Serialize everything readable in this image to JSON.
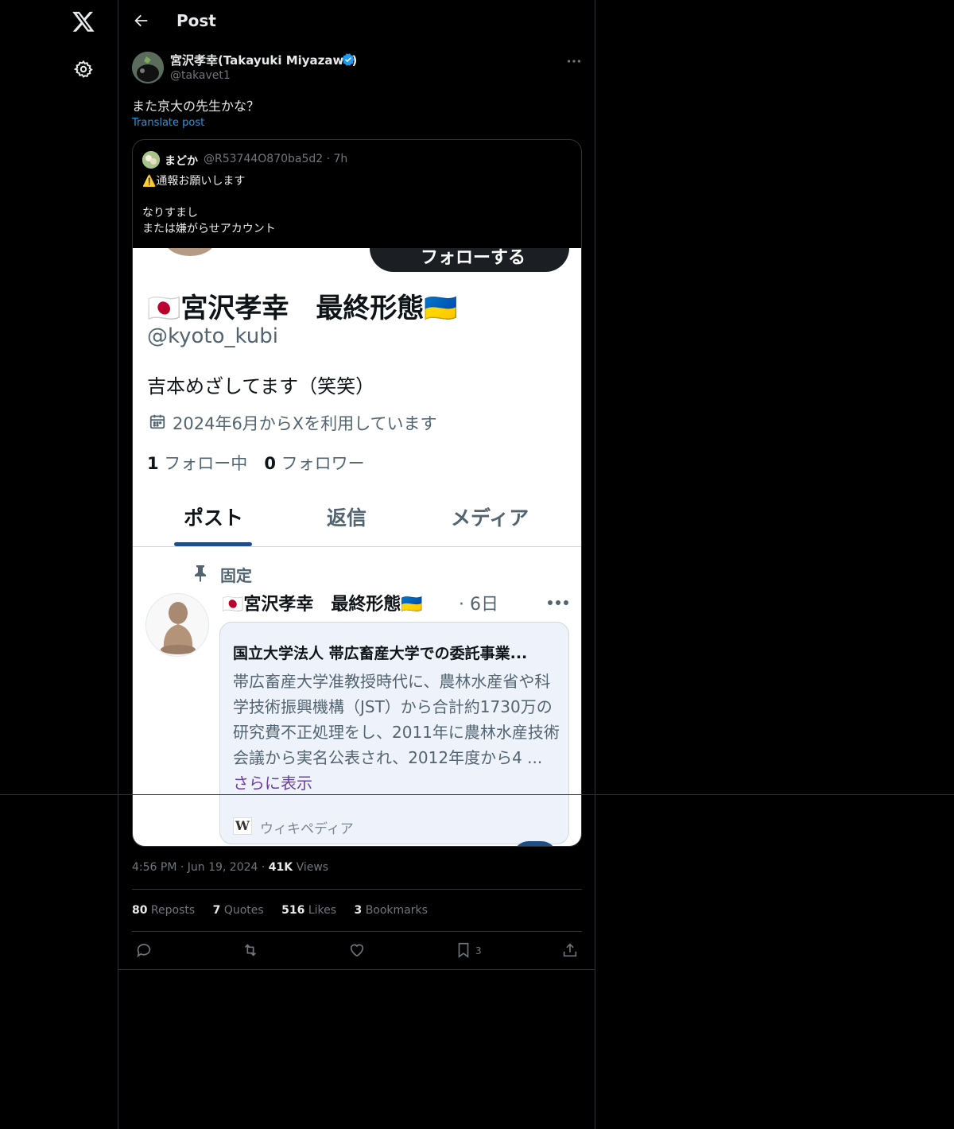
{
  "header": {
    "title": "Post"
  },
  "post": {
    "author_name": "宮沢孝幸(Takayuki Miyazawa)",
    "author_handle": "@takavet1",
    "text": "また京大の先生かな？",
    "translate_label": "Translate post",
    "timestamp": "4:56 PM · Jun 19, 2024 · ",
    "views_count": "41K",
    "views_label": " Views"
  },
  "quote": {
    "name": "まどか",
    "handle": "@R53744O870ba5d2 · 7h",
    "text": "⚠️通報お願いします\n\nなりすまし\nまたは嫌がらせアカウント"
  },
  "screenshot": {
    "follow_label": "フォローする",
    "profile_name": "🇯🇵宮沢孝幸　最終形態🇺🇦",
    "profile_handle": "@kyoto_kubi",
    "bio": "吉本めざしてます（笑笑）",
    "joined": "2024年6月からXを利用しています",
    "following_count": "1",
    "following_label": " フォロー中　",
    "followers_count": "0",
    "followers_label": " フォロワー",
    "tabs": [
      "ポスト",
      "返信",
      "メディア"
    ],
    "pinned_label": "固定",
    "post_name": "🇯🇵宮沢孝幸　最終形態🇺🇦",
    "post_date": "· 6日",
    "card_title": "国立大学法人 帯広畜産大学での委託事業...",
    "card_body": "帯広畜産大学准教授時代に、農林水産省や科学技術振興機構（JST）から合計約1730万の研究費不正処理をし、2011年に農林水産技術会議から実名公表され、2012年度から4 ... ",
    "card_more": "さらに表示",
    "card_source": "ウィキペディア"
  },
  "stats": {
    "reposts_count": "80",
    "reposts_label": " Reposts",
    "quotes_count": "7",
    "quotes_label": " Quotes",
    "likes_count": "516",
    "likes_label": " Likes",
    "bookmarks_count": "3",
    "bookmarks_label": " Bookmarks"
  },
  "actions": {
    "bookmark_count": "3"
  },
  "colors": {
    "accent": "#1d9bf0",
    "background": "#000000",
    "muted": "#71767b",
    "border": "#2f3336"
  }
}
